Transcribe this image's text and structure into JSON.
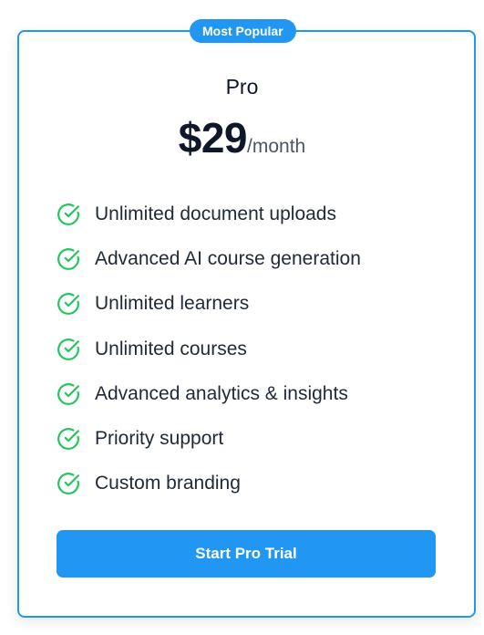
{
  "badge": "Most Popular",
  "plan": {
    "name": "Pro",
    "price": "$29",
    "period": "/month"
  },
  "features": [
    {
      "label": "Unlimited document uploads",
      "icon": "check-circle-icon"
    },
    {
      "label": "Advanced AI course generation",
      "icon": "check-circle-icon"
    },
    {
      "label": "Unlimited learners",
      "icon": "check-circle-icon"
    },
    {
      "label": "Unlimited courses",
      "icon": "check-circle-icon"
    },
    {
      "label": "Advanced analytics & insights",
      "icon": "check-circle-icon"
    },
    {
      "label": "Priority support",
      "icon": "check-circle-icon"
    },
    {
      "label": "Custom branding",
      "icon": "check-circle-icon"
    }
  ],
  "cta": {
    "label": "Start Pro Trial"
  },
  "colors": {
    "accent": "#2196f3",
    "check": "#22c55e",
    "text_dark": "#0f172a",
    "text_muted": "#4b5563"
  }
}
